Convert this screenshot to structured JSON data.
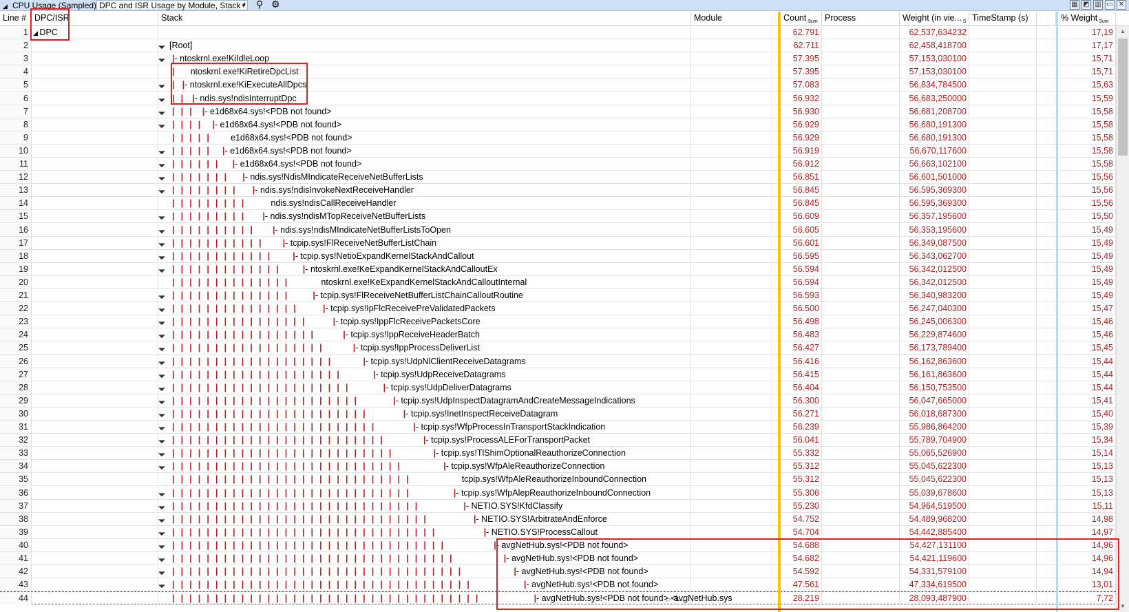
{
  "titlebar": {
    "collapse_glyph": "◢",
    "title": "CPU Usage (Sampled)",
    "view": "DPC and ISR Usage by Module, Stack *",
    "view_chevron": "▾",
    "search_icon": "⚲",
    "gear_icon": "⚙",
    "right_icons": [
      "▦",
      "◩",
      "▥",
      "▭",
      "✕"
    ]
  },
  "columns": {
    "line": "Line #",
    "dpc": "DPC/ISR",
    "stack": "Stack",
    "module": "Module",
    "count": "Count",
    "count_sub": "Sum",
    "process": "Process",
    "weight": "Weight (in vie...",
    "weight_sub": "S",
    "timestamp": "TimeStamp (s)",
    "pct": "% Weight",
    "pct_sub": "Sum"
  },
  "rows": [
    {
      "line": "1",
      "dpc": "DPC",
      "dpc_exp": true,
      "depth": -1,
      "exp": false,
      "stack": "",
      "module": "",
      "count": "62.791",
      "weight": "62,537,634232",
      "pct": "17,19"
    },
    {
      "line": "2",
      "depth": 0,
      "exp": true,
      "stack": "[Root]",
      "count": "62.711",
      "weight": "62,458,418700",
      "pct": "17,17"
    },
    {
      "line": "3",
      "depth": 1,
      "exp": true,
      "stack": "ntoskrnl.exe!KiIdleLoop",
      "count": "57.395",
      "weight": "57,153,030100",
      "pct": "15,71"
    },
    {
      "line": "4",
      "depth": 1,
      "exp": false,
      "plain": true,
      "stack": "ntoskrnl.exe!KiRetireDpcList",
      "count": "57.395",
      "weight": "57,153,030100",
      "pct": "15,71"
    },
    {
      "line": "5",
      "depth": 2,
      "exp": true,
      "stack": "ntoskrnl.exe!KiExecuteAllDpcs",
      "count": "57.083",
      "weight": "56,834,784500",
      "pct": "15,63"
    },
    {
      "line": "6",
      "depth": 3,
      "exp": true,
      "stack": "ndis.sys!ndisInterruptDpc",
      "count": "56.932",
      "weight": "56,683,250000",
      "pct": "15,59"
    },
    {
      "line": "7",
      "depth": 4,
      "exp": true,
      "stack": "e1d68x64.sys!<PDB not found>",
      "count": "56.930",
      "weight": "56,681,208700",
      "pct": "15,58"
    },
    {
      "line": "8",
      "depth": 5,
      "exp": true,
      "stack": "e1d68x64.sys!<PDB not found>",
      "count": "56.929",
      "weight": "56,680,191300",
      "pct": "15,58"
    },
    {
      "line": "9",
      "depth": 5,
      "exp": false,
      "plain": true,
      "stack": "e1d68x64.sys!<PDB not found>",
      "count": "56.929",
      "weight": "56,680,191300",
      "pct": "15,58"
    },
    {
      "line": "10",
      "depth": 6,
      "exp": true,
      "stack": "e1d68x64.sys!<PDB not found>",
      "count": "56.919",
      "weight": "56,670,117600",
      "pct": "15,58"
    },
    {
      "line": "11",
      "depth": 7,
      "exp": true,
      "stack": "e1d68x64.sys!<PDB not found>",
      "count": "56.912",
      "weight": "56,663,102100",
      "pct": "15,58"
    },
    {
      "line": "12",
      "depth": 8,
      "exp": true,
      "stack": "ndis.sys!NdisMIndicateReceiveNetBufferLists",
      "count": "56.851",
      "weight": "56,601,501000",
      "pct": "15,56"
    },
    {
      "line": "13",
      "depth": 9,
      "exp": true,
      "stack": "ndis.sys!ndisInvokeNextReceiveHandler",
      "count": "56.845",
      "weight": "56,595,369300",
      "pct": "15,56"
    },
    {
      "line": "14",
      "depth": 9,
      "exp": false,
      "plain": true,
      "stack": "ndis.sys!ndisCallReceiveHandler",
      "count": "56.845",
      "weight": "56,595,369300",
      "pct": "15,56"
    },
    {
      "line": "15",
      "depth": 10,
      "exp": true,
      "stack": "ndis.sys!ndisMTopReceiveNetBufferLists",
      "count": "56.609",
      "weight": "56,357,195600",
      "pct": "15,50"
    },
    {
      "line": "16",
      "depth": 11,
      "exp": true,
      "stack": "ndis.sys!ndisMIndicateNetBufferListsToOpen",
      "count": "56.605",
      "weight": "56,353,195600",
      "pct": "15,49"
    },
    {
      "line": "17",
      "depth": 12,
      "exp": true,
      "stack": "tcpip.sys!FlReceiveNetBufferListChain",
      "count": "56.601",
      "weight": "56,349,087500",
      "pct": "15,49"
    },
    {
      "line": "18",
      "depth": 13,
      "exp": true,
      "stack": "tcpip.sys!NetioExpandKernelStackAndCallout",
      "count": "56.595",
      "weight": "56,343,062700",
      "pct": "15,49"
    },
    {
      "line": "19",
      "depth": 14,
      "exp": true,
      "stack": "ntoskrnl.exe!KeExpandKernelStackAndCalloutEx",
      "count": "56.594",
      "weight": "56,342,012500",
      "pct": "15,49"
    },
    {
      "line": "20",
      "depth": 14,
      "exp": false,
      "plain": true,
      "stack": "ntoskrnl.exe!KeExpandKernelStackAndCalloutInternal",
      "count": "56.594",
      "weight": "56,342,012500",
      "pct": "15,49"
    },
    {
      "line": "21",
      "depth": 15,
      "exp": true,
      "stack": "tcpip.sys!FlReceiveNetBufferListChainCalloutRoutine",
      "count": "56.593",
      "weight": "56,340,983200",
      "pct": "15,49"
    },
    {
      "line": "22",
      "depth": 16,
      "exp": true,
      "stack": "tcpip.sys!IpFlcReceivePreValidatedPackets",
      "count": "56.500",
      "weight": "56,247,040300",
      "pct": "15,47"
    },
    {
      "line": "23",
      "depth": 17,
      "exp": true,
      "stack": "tcpip.sys!IppFlcReceivePacketsCore",
      "count": "56.498",
      "weight": "56,245,006300",
      "pct": "15,46"
    },
    {
      "line": "24",
      "depth": 18,
      "exp": true,
      "stack": "tcpip.sys!IppReceiveHeaderBatch",
      "count": "56.483",
      "weight": "56,229,874600",
      "pct": "15,46"
    },
    {
      "line": "25",
      "depth": 19,
      "exp": true,
      "stack": "tcpip.sys!IppProcessDeliverList",
      "count": "56.427",
      "weight": "56,173,789400",
      "pct": "15,45"
    },
    {
      "line": "26",
      "depth": 20,
      "exp": true,
      "stack": "tcpip.sys!UdpNlClientReceiveDatagrams",
      "count": "56.416",
      "weight": "56,162,863600",
      "pct": "15,44"
    },
    {
      "line": "27",
      "depth": 21,
      "exp": true,
      "stack": "tcpip.sys!UdpReceiveDatagrams",
      "count": "56.415",
      "weight": "56,161,863600",
      "pct": "15,44"
    },
    {
      "line": "28",
      "depth": 22,
      "exp": true,
      "stack": "tcpip.sys!UdpDeliverDatagrams",
      "count": "56.404",
      "weight": "56,150,753500",
      "pct": "15,44"
    },
    {
      "line": "29",
      "depth": 23,
      "exp": true,
      "stack": "tcpip.sys!UdpInspectDatagramAndCreateMessageIndications",
      "count": "56.300",
      "weight": "56,047,665000",
      "pct": "15,41"
    },
    {
      "line": "30",
      "depth": 24,
      "exp": true,
      "stack": "tcpip.sys!InetInspectReceiveDatagram",
      "count": "56.271",
      "weight": "56,018,687300",
      "pct": "15,40"
    },
    {
      "line": "31",
      "depth": 25,
      "exp": true,
      "stack": "tcpip.sys!WfpProcessInTransportStackIndication",
      "count": "56.239",
      "weight": "55,986,864200",
      "pct": "15,39"
    },
    {
      "line": "32",
      "depth": 26,
      "exp": true,
      "stack": "tcpip.sys!ProcessALEForTransportPacket",
      "count": "56.041",
      "weight": "55,789,704900",
      "pct": "15,34"
    },
    {
      "line": "33",
      "depth": 27,
      "exp": true,
      "stack": "tcpip.sys!TlShimOptionalReauthorizeConnection",
      "count": "55.332",
      "weight": "55,065,526900",
      "pct": "15,14"
    },
    {
      "line": "34",
      "depth": 28,
      "exp": true,
      "stack": "tcpip.sys!WfpAleReauthorizeConnection",
      "count": "55.312",
      "weight": "55,045,622300",
      "pct": "15,13"
    },
    {
      "line": "35",
      "depth": 28,
      "exp": false,
      "plain": true,
      "stack": "tcpip.sys!WfpAleReauthorizeInboundConnection",
      "count": "55.312",
      "weight": "55,045,622300",
      "pct": "15,13"
    },
    {
      "line": "36",
      "depth": 29,
      "exp": true,
      "stack": "tcpip.sys!WfpAlepReauthorizeInboundConnection",
      "count": "55.306",
      "weight": "55,039,678600",
      "pct": "15,13"
    },
    {
      "line": "37",
      "depth": 30,
      "exp": true,
      "stack": "NETIO.SYS!KfdClassify",
      "count": "55.230",
      "weight": "54,964,519500",
      "pct": "15,11"
    },
    {
      "line": "38",
      "depth": 31,
      "exp": true,
      "stack": "NETIO.SYS!ArbitrateAndEnforce",
      "count": "54.752",
      "weight": "54,489,968200",
      "pct": "14,98"
    },
    {
      "line": "39",
      "depth": 32,
      "exp": true,
      "stack": "NETIO.SYS!ProcessCallout",
      "count": "54.704",
      "weight": "54,442,885400",
      "pct": "14,97"
    },
    {
      "line": "40",
      "depth": 33,
      "exp": true,
      "stack": "avgNetHub.sys!<PDB not found>",
      "count": "54.688",
      "weight": "54,427,131100",
      "pct": "14,96"
    },
    {
      "line": "41",
      "depth": 34,
      "exp": true,
      "stack": "avgNetHub.sys!<PDB not found>",
      "count": "54.682",
      "weight": "54,421,119600",
      "pct": "14,96"
    },
    {
      "line": "42",
      "depth": 35,
      "exp": true,
      "stack": "avgNetHub.sys!<PDB not found>",
      "count": "54.592",
      "weight": "54,331,579100",
      "pct": "14,94"
    },
    {
      "line": "43",
      "depth": 36,
      "exp": true,
      "stack": "avgNetHub.sys!<PDB not found>",
      "count": "47.561",
      "weight": "47,334,619500",
      "pct": "13,01"
    },
    {
      "line": "44",
      "depth": 37,
      "exp": false,
      "stack": "avgNetHub.sys!<PDB not found> <i...",
      "module": "avgNetHub.sys",
      "module_exp": true,
      "count": "28.219",
      "weight": "28,093,487900",
      "pct": "7,72"
    }
  ],
  "colors": {
    "accent": "#f5c400",
    "highlight": "#e02020",
    "values": "#b22020",
    "sort_bar": "#b8dce8"
  }
}
